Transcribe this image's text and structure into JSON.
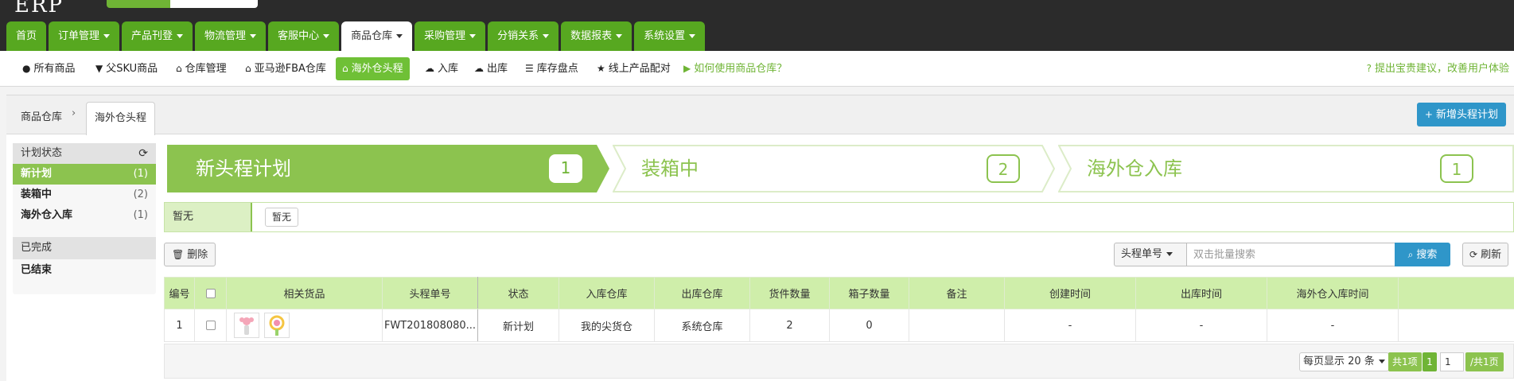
{
  "colors": {
    "brand_green": "#57a820",
    "accent_green": "#8cc34f",
    "primary_blue": "#2f96c9",
    "topbar": "#2b2b2b"
  },
  "main_nav": {
    "tabs": [
      {
        "label": "首页",
        "caret": false
      },
      {
        "label": "订单管理",
        "caret": true
      },
      {
        "label": "产品刊登",
        "caret": true
      },
      {
        "label": "物流管理",
        "caret": true
      },
      {
        "label": "客服中心",
        "caret": true
      },
      {
        "label": "商品仓库",
        "caret": true,
        "active": true
      },
      {
        "label": "采购管理",
        "caret": true
      },
      {
        "label": "分销关系",
        "caret": true
      },
      {
        "label": "数据报表",
        "caret": true
      },
      {
        "label": "系统设置",
        "caret": true
      }
    ]
  },
  "sub_nav": {
    "items": [
      {
        "label": "所有商品",
        "icon": "circle-icon"
      },
      {
        "label": "父SKU商品",
        "icon": "filter-icon"
      },
      {
        "label": "仓库管理",
        "icon": "home-icon"
      },
      {
        "label": "亚马逊FBA仓库",
        "icon": "home-icon"
      },
      {
        "label": "海外仓头程",
        "icon": "home-icon",
        "active": true
      },
      {
        "label": "入库",
        "icon": "cloud-upload-icon"
      },
      {
        "label": "出库",
        "icon": "cloud-download-icon"
      },
      {
        "label": "库存盘点",
        "icon": "list-icon"
      },
      {
        "label": "线上产品配对",
        "icon": "star-icon"
      },
      {
        "label": "如何使用商品仓库？",
        "icon": "video-icon"
      }
    ],
    "feedback": "提出宝贵建议，改善用户体验"
  },
  "breadcrumb": {
    "root": "商品仓库",
    "separator": "›",
    "current": "海外仓头程"
  },
  "add_button": "新增头程计划",
  "sidebar": {
    "header": "计划状态",
    "items": [
      {
        "label": "新计划",
        "count": "(1)",
        "active": true
      },
      {
        "label": "装箱中",
        "count": "(2)"
      },
      {
        "label": "海外仓入库",
        "count": "(1)"
      }
    ],
    "done_header": "已完成",
    "done_items": [
      {
        "label": "已结束"
      }
    ]
  },
  "steps": [
    {
      "label": "新头程计划",
      "count": "1"
    },
    {
      "label": "装箱中",
      "count": "2"
    },
    {
      "label": "海外仓入库",
      "count": "1"
    }
  ],
  "tag_filter": {
    "label": "暂无",
    "button": "暂无"
  },
  "toolbar": {
    "delete": "删除",
    "search_field": "头程单号",
    "search_placeholder": "双击批量搜索",
    "search_button": "搜索",
    "refresh": "刷新"
  },
  "table": {
    "columns": [
      "编号",
      "",
      "相关货品",
      "头程单号",
      "状态",
      "入库仓库",
      "出库仓库",
      "货件数量",
      "箱子数量",
      "备注",
      "创建时间",
      "出库时间",
      "海外仓入库时间",
      ""
    ],
    "rows": [
      {
        "id": "1",
        "order_no": "FWT201808080...",
        "status": "新计划",
        "in_warehouse": "我的尖货仓",
        "out_warehouse": "系统仓库",
        "shipments": "2",
        "boxes": "0",
        "note": "",
        "created": "-",
        "out_time": "-",
        "in_time": "-"
      }
    ]
  },
  "pagination": {
    "per_page": "每页显示 20 条",
    "total": "共1项",
    "current": "1",
    "input": "1",
    "of_pages": "/共1页"
  }
}
